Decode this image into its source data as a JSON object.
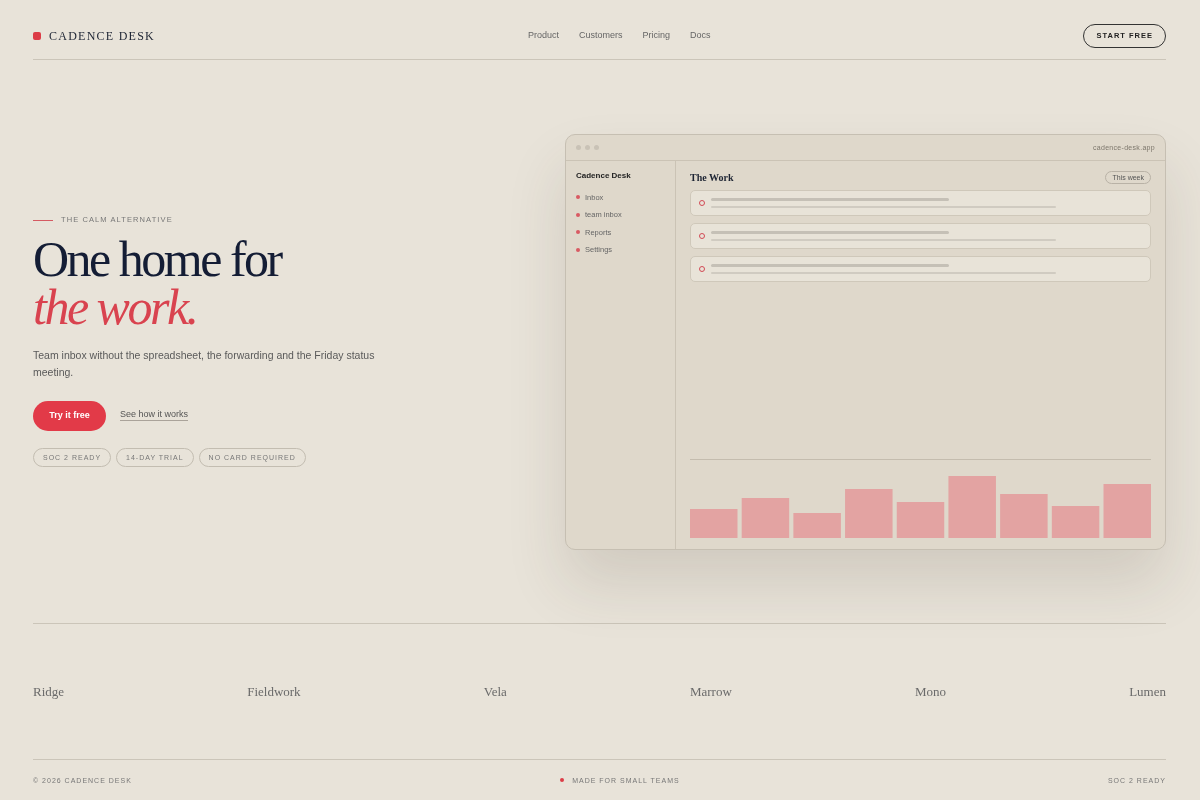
{
  "header": {
    "brand": "CADENCE DESK",
    "nav": [
      "Product",
      "Customers",
      "Pricing",
      "Docs"
    ],
    "cta": "START FREE"
  },
  "hero": {
    "eyebrow": "THE CALM ALTERNATIVE",
    "headline": "One home for",
    "headline_accent": "the work.",
    "lede": "Team inbox without the spreadsheet, the forwarding and the Friday status meeting.",
    "primary_button": "Try it free",
    "secondary_link": "See how it works",
    "badges": [
      "SOC 2 READY",
      "14-DAY TRIAL",
      "NO CARD REQUIRED"
    ]
  },
  "app_preview": {
    "address": "cadence-desk.app",
    "sidebar": {
      "title": "Cadence Desk",
      "items": [
        "Inbox",
        "team inbox",
        "Reports",
        "Settings"
      ]
    },
    "main": {
      "title": "The Work",
      "range_button": "This week"
    }
  },
  "logos": [
    "Ridge",
    "Fieldwork",
    "Vela",
    "Marrow",
    "Mono",
    "Lumen"
  ],
  "footer": {
    "copyright": "© 2026 CADENCE DESK",
    "tagline": "MADE FOR SMALL TEAMS",
    "compliance": "SOC 2 READY"
  }
}
